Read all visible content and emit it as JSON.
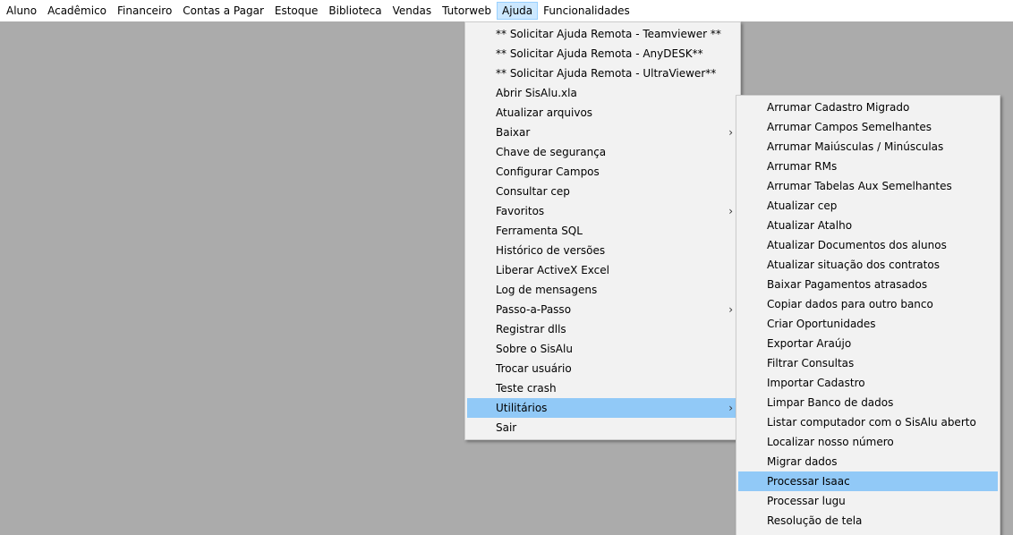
{
  "menubar": {
    "items": [
      {
        "label": "Aluno"
      },
      {
        "label": "Acadêmico"
      },
      {
        "label": "Financeiro"
      },
      {
        "label": "Contas a Pagar"
      },
      {
        "label": "Estoque"
      },
      {
        "label": "Biblioteca"
      },
      {
        "label": "Vendas"
      },
      {
        "label": "Tutorweb"
      },
      {
        "label": "Ajuda"
      },
      {
        "label": "Funcionalidades"
      }
    ]
  },
  "ajuda_menu": {
    "items": [
      {
        "label": "** Solicitar Ajuda Remota - Teamviewer **"
      },
      {
        "label": "** Solicitar Ajuda Remota - AnyDESK**"
      },
      {
        "label": "** Solicitar Ajuda Remota - UltraViewer**"
      },
      {
        "label": "Abrir SisAlu.xla"
      },
      {
        "label": "Atualizar arquivos"
      },
      {
        "label": "Baixar"
      },
      {
        "label": "Chave de segurança"
      },
      {
        "label": "Configurar Campos"
      },
      {
        "label": "Consultar cep"
      },
      {
        "label": "Favoritos"
      },
      {
        "label": "Ferramenta SQL"
      },
      {
        "label": "Histórico de versões"
      },
      {
        "label": "Liberar ActiveX Excel"
      },
      {
        "label": "Log de mensagens"
      },
      {
        "label": "Passo-a-Passo"
      },
      {
        "label": "Registrar dlls"
      },
      {
        "label": "Sobre o SisAlu"
      },
      {
        "label": "Trocar usuário"
      },
      {
        "label": "Teste crash"
      },
      {
        "label": "Utilitários"
      },
      {
        "label": "Sair"
      }
    ],
    "arrow": "›"
  },
  "utilitarios_menu": {
    "items": [
      {
        "label": "Arrumar Cadastro Migrado"
      },
      {
        "label": "Arrumar Campos Semelhantes"
      },
      {
        "label": "Arrumar Maiúsculas / Minúsculas"
      },
      {
        "label": "Arrumar RMs"
      },
      {
        "label": "Arrumar Tabelas Aux Semelhantes"
      },
      {
        "label": "Atualizar cep"
      },
      {
        "label": "Atualizar Atalho"
      },
      {
        "label": "Atualizar Documentos dos alunos"
      },
      {
        "label": "Atualizar situação dos contratos"
      },
      {
        "label": "Baixar Pagamentos atrasados"
      },
      {
        "label": "Copiar dados para outro banco"
      },
      {
        "label": "Criar Oportunidades"
      },
      {
        "label": "Exportar Araújo"
      },
      {
        "label": "Filtrar Consultas"
      },
      {
        "label": "Importar Cadastro"
      },
      {
        "label": "Limpar Banco de dados"
      },
      {
        "label": "Listar computador com o SisAlu aberto"
      },
      {
        "label": "Localizar nosso número"
      },
      {
        "label": "Migrar dados"
      },
      {
        "label": "Processar Isaac"
      },
      {
        "label": "Processar lugu"
      },
      {
        "label": "Resolução de tela"
      }
    ]
  },
  "colors": {
    "desktop": "#ababab",
    "menu_bg": "#f2f2f2",
    "highlight": "#91c9f7",
    "menubar_open": "#cce8ff"
  }
}
